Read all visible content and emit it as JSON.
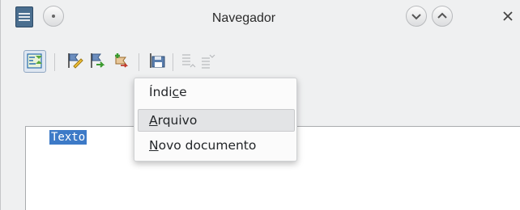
{
  "window": {
    "title": "Navegador",
    "icons": [
      "document-icon",
      "window-menu-icon",
      "minimize-icon",
      "maximize-icon",
      "close-icon"
    ]
  },
  "toolbar": {
    "buttons": [
      {
        "icon": "content-view-toggle-icon",
        "active": true
      },
      {
        "icon": "edit-entry-icon"
      },
      {
        "icon": "move-entry-icon"
      },
      {
        "icon": "insert-entry-icon"
      },
      {
        "icon": "save-as-icon"
      },
      {
        "icon": "promote-level-icon"
      },
      {
        "icon": "demote-level-icon"
      }
    ]
  },
  "menu": {
    "items": [
      {
        "label": "Índice",
        "mnemonic": "c"
      },
      {
        "label": "Arquivo",
        "mnemonic": "A",
        "highlighted": true
      },
      {
        "label": "Novo documento",
        "mnemonic": "N"
      }
    ]
  },
  "content": {
    "selected_text": "Texto"
  },
  "colors": {
    "selection": "#3d7ac7",
    "window_bg": "#eff0f1"
  }
}
